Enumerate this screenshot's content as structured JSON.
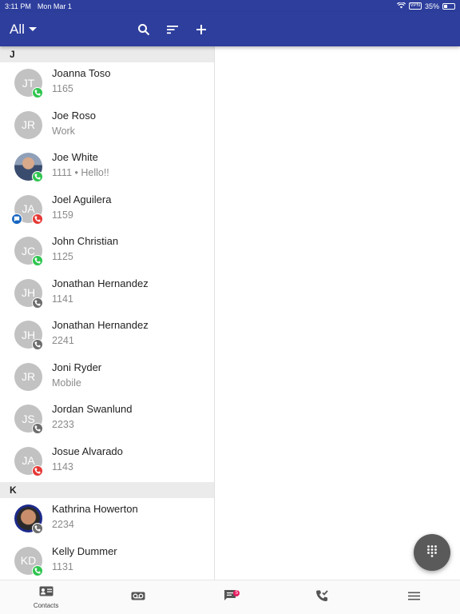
{
  "status_bar": {
    "time": "3:11 PM",
    "date": "Mon Mar 1",
    "vpn_label": "VPN",
    "battery_text": "35%",
    "battery_level": 0.35
  },
  "app_bar": {
    "filter_label": "All",
    "icons": [
      "search-icon",
      "sort-icon",
      "add-icon"
    ]
  },
  "sections": [
    {
      "letter": "J",
      "contacts": [
        {
          "initials": "JT",
          "name": "Joanna Toso",
          "detail": "1165",
          "status": "green",
          "photo": ""
        },
        {
          "initials": "JR",
          "name": "Joe Roso",
          "detail": "Work",
          "status": "",
          "photo": ""
        },
        {
          "initials": "",
          "name": "Joe White",
          "detail": "1111 • Hello!!",
          "status": "green",
          "photo": "photo1"
        },
        {
          "initials": "JA",
          "name": "Joel Aguilera",
          "detail": "1159",
          "status": "red",
          "chat": true,
          "photo": ""
        },
        {
          "initials": "JC",
          "name": "John Christian",
          "detail": "1125",
          "status": "green",
          "photo": ""
        },
        {
          "initials": "JH",
          "name": "Jonathan Hernandez",
          "detail": "1141",
          "status": "gray",
          "photo": ""
        },
        {
          "initials": "JH",
          "name": "Jonathan Hernandez",
          "detail": "2241",
          "status": "gray",
          "photo": ""
        },
        {
          "initials": "JR",
          "name": "Joni Ryder",
          "detail": "Mobile",
          "status": "",
          "photo": ""
        },
        {
          "initials": "JS",
          "name": "Jordan Swanlund",
          "detail": "2233",
          "status": "gray",
          "photo": ""
        },
        {
          "initials": "JA",
          "name": "Josue Alvarado",
          "detail": "1143",
          "status": "red",
          "photo": ""
        }
      ]
    },
    {
      "letter": "K",
      "contacts": [
        {
          "initials": "",
          "name": "Kathrina Howerton",
          "detail": "2234",
          "status": "gray",
          "photo": "photo2"
        },
        {
          "initials": "KD",
          "name": "Kelly Dummer",
          "detail": "1131",
          "status": "green",
          "photo": ""
        }
      ]
    }
  ],
  "bottom_nav": {
    "items": [
      {
        "label": "Contacts",
        "icon": "contacts-icon"
      },
      {
        "label": "",
        "icon": "voicemail-icon"
      },
      {
        "label": "",
        "icon": "messages-icon",
        "badge": "5"
      },
      {
        "label": "",
        "icon": "call-history-icon"
      },
      {
        "label": "",
        "icon": "menu-icon"
      }
    ]
  },
  "colors": {
    "primary": "#2d3e9d",
    "status_green": "#2fc54f",
    "status_red": "#e53935",
    "status_gray": "#6d6d6d",
    "chat_blue": "#1565c0",
    "message_badge": "#e91e63"
  }
}
